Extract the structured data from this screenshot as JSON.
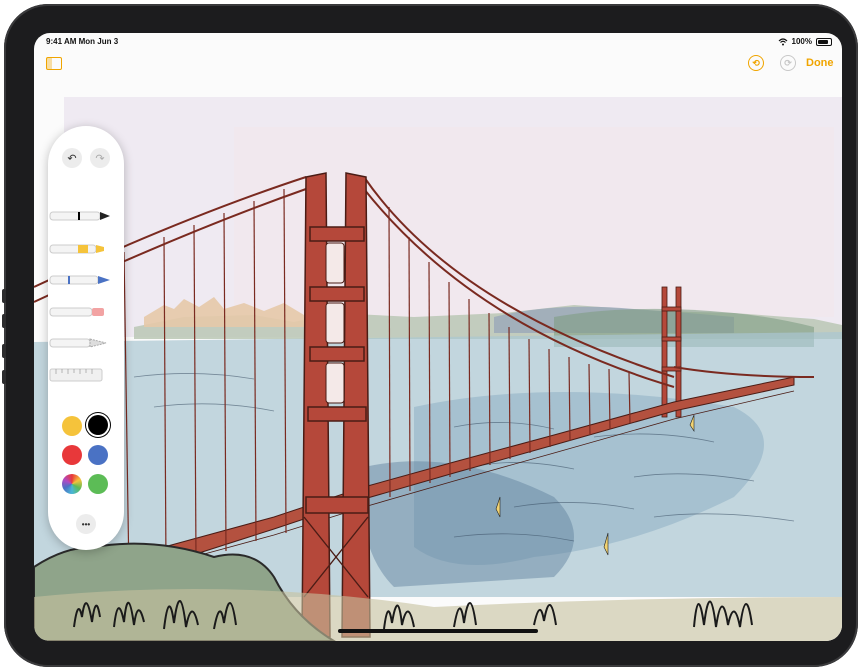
{
  "statusbar": {
    "time": "9:41 AM  Mon Jun 3",
    "battery": "100%"
  },
  "toolbar": {
    "done_label": "Done",
    "undo_glyph": "⟲",
    "redo_glyph": "⟳"
  },
  "palette": {
    "undo_glyph": "↶",
    "redo_glyph": "↷",
    "more_glyph": "•••",
    "colors": {
      "yellow": "#f5c33b",
      "black": "#000000",
      "red": "#e8383a",
      "blue": "#4a72c4",
      "green": "#5cbc56"
    },
    "tools": [
      "pen-tool",
      "marker-tool",
      "pencil-tool",
      "eraser-tool",
      "lasso-tool",
      "ruler-tool"
    ]
  },
  "colors": {
    "accent": "#f0a500"
  }
}
